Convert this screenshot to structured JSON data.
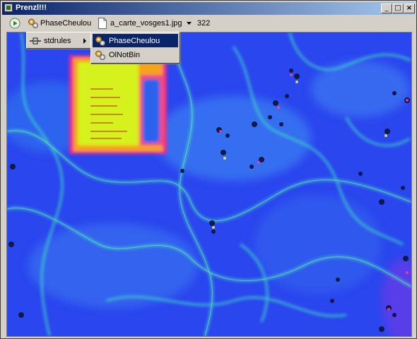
{
  "window": {
    "title": "Prenzl!!!",
    "controls": {
      "minimize": "_",
      "maximize": "□",
      "close": "×"
    }
  },
  "toolbar": {
    "play_icon": "play-icon",
    "filter_button": {
      "label": "PhaseCheulou",
      "icon": "gears-icon"
    },
    "file_button": {
      "label": "a_carte_vosges1.jpg",
      "icon": "document-icon"
    },
    "dropdown_icon": "chevron-down-icon",
    "value": "322"
  },
  "menus": {
    "category_menu": {
      "items": [
        {
          "label": "stdrules",
          "icon": "rule-icon",
          "has_submenu": true
        }
      ]
    },
    "submenu": {
      "items": [
        {
          "label": "PhaseCheulou",
          "icon": "gears-icon",
          "selected": true
        },
        {
          "label": "OlNotBin",
          "icon": "gears-icon",
          "selected": false
        }
      ]
    }
  },
  "colors": {
    "title_active": "#0a246a",
    "menu_highlight": "#0a246a",
    "chrome": "#d4d0c8",
    "heatmap_base": "#2a46ee",
    "heatmap_edge": "#3fe3c4"
  }
}
